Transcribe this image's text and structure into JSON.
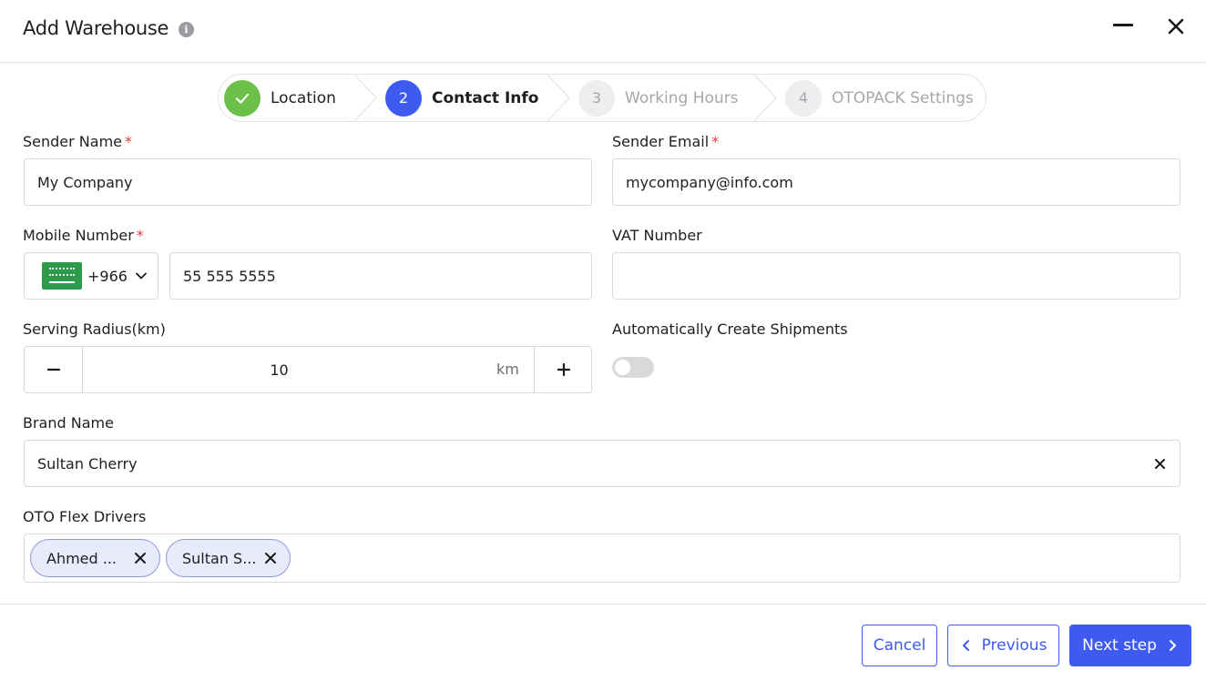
{
  "header": {
    "title": "Add Warehouse",
    "info_icon": "info-icon",
    "minimize_icon": "minimize-icon",
    "close_icon": "close-icon"
  },
  "stepper": {
    "steps": [
      {
        "number": "",
        "label": "Location",
        "state": "completed",
        "icon": "check-icon"
      },
      {
        "number": "2",
        "label": "Contact Info",
        "state": "active"
      },
      {
        "number": "3",
        "label": "Working Hours",
        "state": "upcoming"
      },
      {
        "number": "4",
        "label": "OTOPACK Settings",
        "state": "upcoming"
      }
    ],
    "colors": {
      "completed": "#6cc04a",
      "active": "#3d5af1",
      "upcoming": "#eeeef0"
    }
  },
  "form": {
    "sender_name": {
      "label": "Sender Name",
      "required_mark": "*",
      "value": "My Company"
    },
    "sender_email": {
      "label": "Sender Email",
      "required_mark": "*",
      "value": "mycompany@info.com"
    },
    "mobile_number": {
      "label": "Mobile Number",
      "required_mark": "*",
      "country_code": "+966",
      "flag_icon": "saudi-arabia-flag-icon",
      "value": "55 555 5555"
    },
    "vat_number": {
      "label": "VAT Number",
      "value": ""
    },
    "serving_radius": {
      "label": "Serving Radius(km)",
      "value": "10",
      "unit": "km",
      "decrement_icon": "minus-icon",
      "increment_icon": "plus-icon"
    },
    "auto_create_shipments": {
      "label": "Automatically Create Shipments",
      "enabled": false
    },
    "brand_name": {
      "label": "Brand Name",
      "value": "Sultan Cherry",
      "clear_icon": "close-icon"
    },
    "oto_flex_drivers": {
      "label": "OTO Flex Drivers",
      "chips": [
        "Ahmed ...",
        "Sultan S..."
      ]
    }
  },
  "footer": {
    "cancel_label": "Cancel",
    "previous_label": "Previous",
    "next_label": "Next step"
  },
  "colors": {
    "accent": "#3d5af1",
    "required": "#e53935",
    "success": "#6cc04a"
  }
}
